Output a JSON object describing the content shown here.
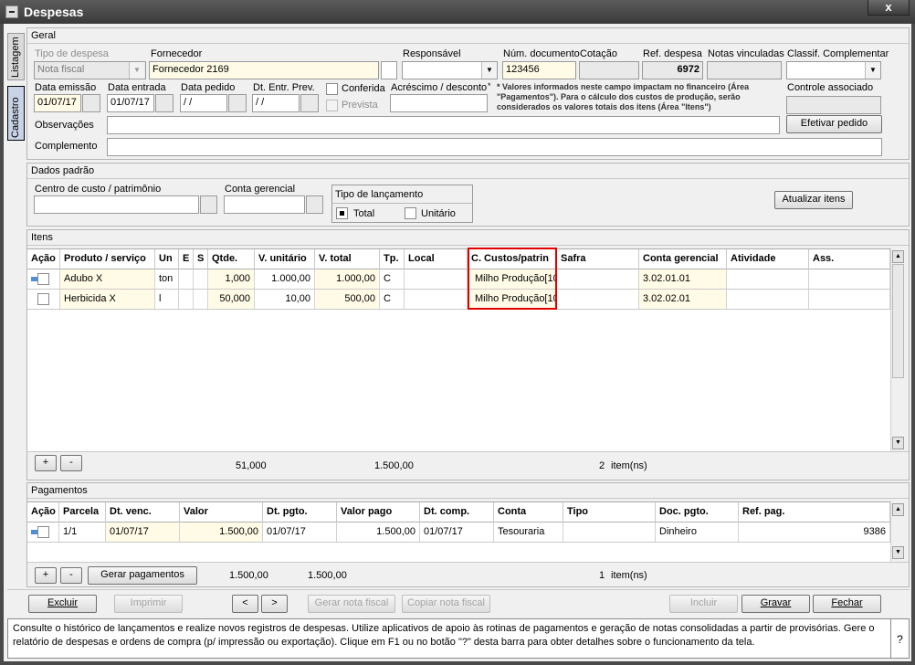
{
  "window": {
    "title": "Despesas",
    "close_label": "x"
  },
  "side_tabs": {
    "listagem": "Listagem",
    "cadastro": "Cadastro"
  },
  "geral": {
    "header": "Geral",
    "tipo_despesa_label": "Tipo de despesa",
    "tipo_despesa_value": "Nota fiscal",
    "fornecedor_label": "Fornecedor",
    "fornecedor_value": "Fornecedor 2169",
    "responsavel_label": "Responsável",
    "responsavel_value": "",
    "num_documento_label": "Núm. documento",
    "num_documento_value": "123456",
    "cotacao_label": "Cotação",
    "cotacao_value": "",
    "ref_despesa_label": "Ref. despesa",
    "ref_despesa_value": "6972",
    "notas_vinculadas_label": "Notas vinculadas",
    "notas_vinculadas_value": "",
    "classif_label": "Classif. Complementar",
    "classif_value": "",
    "data_emissao_label": "Data emissão",
    "data_emissao_value": "01/07/17",
    "data_entrada_label": "Data entrada",
    "data_entrada_value": "01/07/17",
    "data_pedido_label": "Data pedido",
    "data_pedido_value": " / /",
    "dt_entr_prev_label": "Dt. Entr. Prev.",
    "dt_entr_prev_value": " / /",
    "conferida_label": "Conferida",
    "prevista_label": "Prevista",
    "acrescimo_label": "Acréscimo / desconto",
    "acrescimo_value": "",
    "asterisk": "*",
    "note": "* Valores informados neste campo impactam no financeiro (Área \"Pagamentos\"). Para o cálculo dos custos de produção, serão considerados os valores totais dos itens (Área \"Itens\")",
    "controle_label": "Controle associado",
    "controle_value": "",
    "observacoes_label": "Observações",
    "observacoes_value": "",
    "efetivar_label": "Efetivar pedido",
    "complemento_label": "Complemento",
    "complemento_value": ""
  },
  "dados_padrao": {
    "header": "Dados padrão",
    "centro_custo_label": "Centro de custo / patrimônio",
    "centro_custo_value": "",
    "conta_gerencial_label": "Conta gerencial",
    "conta_gerencial_value": "",
    "tipo_lancamento_label": "Tipo de lançamento",
    "total_label": "Total",
    "unitario_label": "Unitário",
    "atualizar_label": "Atualizar itens"
  },
  "itens": {
    "header": "Itens",
    "columns": [
      "Ação",
      "Produto / serviço",
      "Un",
      "E",
      "S",
      "Qtde.",
      "V. unitário",
      "V. total",
      "Tp.",
      "Local",
      "C. Custos/patrin",
      "Safra",
      "Conta gerencial",
      "Atividade",
      "Ass."
    ],
    "rows": [
      {
        "produto": "Adubo X",
        "un": "ton",
        "e": "",
        "s": "",
        "qtde": "1,000",
        "v_unit": "1.000,00",
        "v_total": "1.000,00",
        "tp": "C",
        "local": "",
        "c_custos": "Milho  Produção[10",
        "safra": "",
        "conta": "3.02.01.01",
        "atividade": "",
        "ass": ""
      },
      {
        "produto": "Herbicida X",
        "un": "l",
        "e": "",
        "s": "",
        "qtde": "50,000",
        "v_unit": "10,00",
        "v_total": "500,00",
        "tp": "C",
        "local": "",
        "c_custos": "Milho  Produção[10",
        "safra": "",
        "conta": "3.02.02.01",
        "atividade": "",
        "ass": ""
      }
    ],
    "add_label": "+",
    "remove_label": "-",
    "total_qtde": "51,000",
    "total_valor": "1.500,00",
    "count": "2",
    "count_suffix": "item(ns)"
  },
  "pagamentos": {
    "header": "Pagamentos",
    "columns": [
      "Ação",
      "Parcela",
      "Dt. venc.",
      "Valor",
      "Dt. pgto.",
      "Valor pago",
      "Dt. comp.",
      "Conta",
      "Tipo",
      "Doc. pgto.",
      "Ref. pag."
    ],
    "rows": [
      {
        "parcela": "1/1",
        "dt_venc": "01/07/17",
        "valor": "1.500,00",
        "dt_pgto": "01/07/17",
        "valor_pago": "1.500,00",
        "dt_comp": "01/07/17",
        "conta": "Tesouraria",
        "tipo": "",
        "doc_pgto": "Dinheiro",
        "ref_pag": "9386"
      }
    ],
    "add_label": "+",
    "remove_label": "-",
    "gerar_label": "Gerar pagamentos",
    "total_valor": "1.500,00",
    "total_pago": "1.500,00",
    "count": "1",
    "count_suffix": "item(ns)"
  },
  "actions": {
    "excluir": "Excluir",
    "imprimir": "Imprimir",
    "prev": "<",
    "next": ">",
    "gerar_nota": "Gerar nota fiscal",
    "copiar_nota": "Copiar nota fiscal",
    "incluir": "Incluir",
    "gravar": "Gravar",
    "fechar": "Fechar"
  },
  "help": {
    "text": "Consulte o histórico de lançamentos e realize novos registros de despesas. Utilize aplicativos de apoio às rotinas de pagamentos e geração de notas consolidadas a partir de provisórias. Gere o relatório de despesas e ordens de compra (p/ impressão ou exportação). Clique em F1 ou no botão \"?\" desta barra para obter detalhes sobre o funcionamento da tela.",
    "button": "?"
  },
  "colors": {
    "highlight_box": "#e00000",
    "yellow_field": "#fffbe6",
    "selected_tab": "#c9d3e6"
  }
}
